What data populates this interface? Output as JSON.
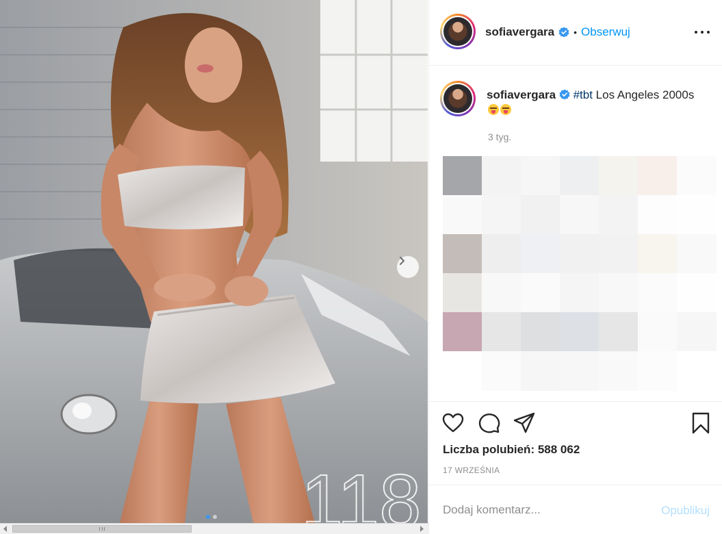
{
  "photo": {
    "overlay_number": "118",
    "slides_total": 2,
    "slide_active": 1
  },
  "post": {
    "header": {
      "username": "sofiavergara",
      "separator": "•",
      "follow_label": "Obserwuj"
    },
    "caption": {
      "username": "sofiavergara",
      "hashtag": "#tbt",
      "text": " Los Angeles 2000s",
      "emoji": [
        "squinting-face-with-tongue",
        "squinting-face-with-tongue"
      ],
      "time": "3 tyg."
    },
    "likes_label": "Liczba polubień: 588 062",
    "date": "17 WRZEŚNIA",
    "comment": {
      "placeholder": "Dodaj komentarz...",
      "value": "",
      "publish_label": "Opublikuj"
    }
  },
  "colors": {
    "accent": "#0095f6",
    "hashtag": "#00376b",
    "muted": "#8e8e8e",
    "publish_disabled": "#b2dffc"
  },
  "icons": {
    "next": "chevron-right-icon",
    "more": "more-horizontal-icon",
    "verified": "verified-badge-icon",
    "like": "heart-icon",
    "comment": "comment-bubble-icon",
    "share": "paper-plane-icon",
    "save": "bookmark-icon"
  }
}
